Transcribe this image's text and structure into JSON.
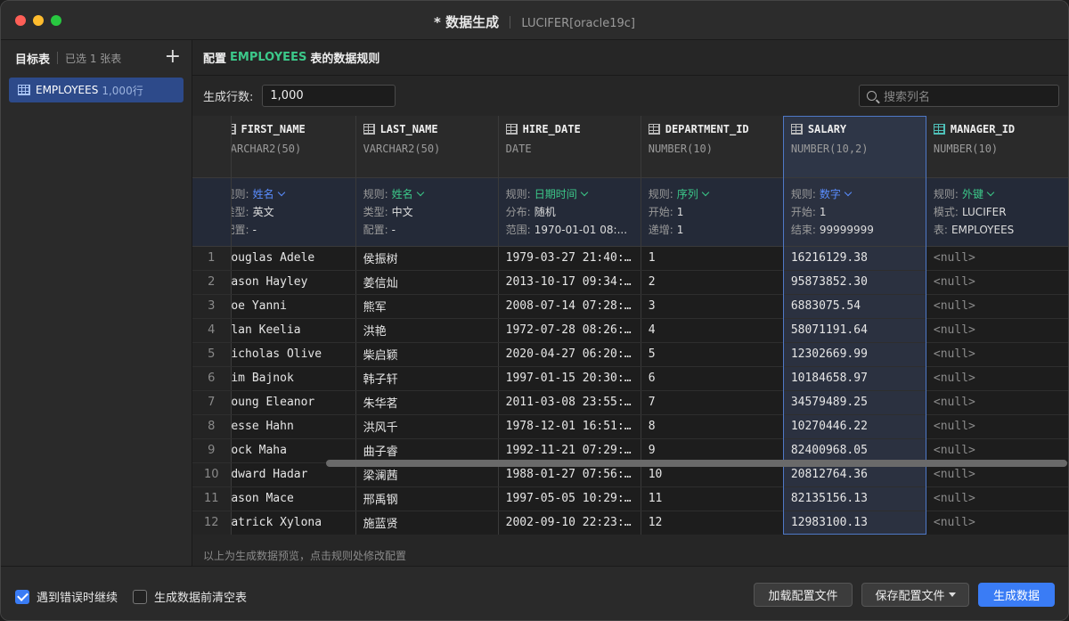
{
  "window": {
    "title": "* 数据生成",
    "connection": "LUCIFER[oracle19c]"
  },
  "sidebar": {
    "title": "目标表",
    "selected_count": "已选 1 张表",
    "add_icon": "plus-icon",
    "tables": [
      {
        "name": "EMPLOYEES",
        "rows": "1,000行"
      }
    ]
  },
  "config": {
    "prefix": "配置",
    "table": "EMPLOYEES",
    "suffix": "表的数据规则",
    "rows_label": "生成行数:",
    "rows_value": "1,000",
    "search_placeholder": "搜索列名"
  },
  "columns": [
    {
      "name": "FIRST_NAME",
      "type": "VARCHAR2(50)",
      "rules": [
        {
          "k": "规则:",
          "v": "姓名",
          "style": "blue",
          "dropdown": true
        },
        {
          "k": "类型:",
          "v": "英文"
        },
        {
          "k": "配置:",
          "v": "-"
        }
      ]
    },
    {
      "name": "LAST_NAME",
      "type": "VARCHAR2(50)",
      "rules": [
        {
          "k": "规则:",
          "v": "姓名",
          "style": "green",
          "dropdown": true
        },
        {
          "k": "类型:",
          "v": "中文"
        },
        {
          "k": "配置:",
          "v": "-"
        }
      ]
    },
    {
      "name": "HIRE_DATE",
      "type": "DATE",
      "rules": [
        {
          "k": "规则:",
          "v": "日期时间",
          "style": "green",
          "dropdown": true
        },
        {
          "k": "分布:",
          "v": "随机"
        },
        {
          "k": "范围:",
          "v": "1970-01-01 08:..."
        }
      ]
    },
    {
      "name": "DEPARTMENT_ID",
      "type": "NUMBER(10)",
      "rules": [
        {
          "k": "规则:",
          "v": "序列",
          "style": "green",
          "dropdown": true
        },
        {
          "k": "开始:",
          "v": "1"
        },
        {
          "k": "递增:",
          "v": "1"
        }
      ]
    },
    {
      "name": "SALARY",
      "type": "NUMBER(10,2)",
      "rules": [
        {
          "k": "规则:",
          "v": "数字",
          "style": "blue",
          "dropdown": true
        },
        {
          "k": "开始:",
          "v": "1"
        },
        {
          "k": "结束:",
          "v": "99999999"
        }
      ]
    },
    {
      "name": "MANAGER_ID",
      "type": "NUMBER(10)",
      "rules": [
        {
          "k": "规则:",
          "v": "外键",
          "style": "green",
          "dropdown": true
        },
        {
          "k": "模式:",
          "v": "LUCIFER"
        },
        {
          "k": "表:",
          "v": "EMPLOYEES"
        }
      ]
    }
  ],
  "rows": [
    [
      "1",
      "Douglas Adele",
      "侯振树",
      "1979-03-27 21:40:…",
      "1",
      "16216129.38",
      "<null>"
    ],
    [
      "2",
      "Mason Hayley",
      "姜信灿",
      "2013-10-17 09:34:…",
      "2",
      "95873852.30",
      "<null>"
    ],
    [
      "3",
      "Zoe Yanni",
      "熊军",
      "2008-07-14 07:28:…",
      "3",
      "6883075.54",
      "<null>"
    ],
    [
      "4",
      "Alan Keelia",
      "洪艳",
      "1972-07-28 08:26:…",
      "4",
      "58071191.64",
      "<null>"
    ],
    [
      "5",
      "Nicholas Olive",
      "柴启颖",
      "2020-04-27 06:20:…",
      "5",
      "12302669.99",
      "<null>"
    ],
    [
      "6",
      "Tim Bajnok",
      "韩子轩",
      "1997-01-15 20:30:…",
      "6",
      "10184658.97",
      "<null>"
    ],
    [
      "7",
      "Young Eleanor",
      "朱华茗",
      "2011-03-08 23:55:…",
      "7",
      "34579489.25",
      "<null>"
    ],
    [
      "8",
      "Jesse Hahn",
      "洪风千",
      "1978-12-01 16:51:…",
      "8",
      "10270446.22",
      "<null>"
    ],
    [
      "9",
      "Jock Maha",
      "曲子睿",
      "1992-11-21 07:29:…",
      "9",
      "82400968.05",
      "<null>"
    ],
    [
      "10",
      "Edward Hadar",
      "梁澜茜",
      "1988-01-27 07:56:…",
      "10",
      "20812764.36",
      "<null>"
    ],
    [
      "11",
      "Mason Mace",
      "邢禹钢",
      "1997-05-05 10:29:…",
      "11",
      "82135156.13",
      "<null>"
    ],
    [
      "12",
      "Patrick Xylona",
      "施蓝贤",
      "2002-09-10 22:23:…",
      "12",
      "12983100.13",
      "<null>"
    ]
  ],
  "preview_note": "以上为生成数据预览，点击规则处修改配置",
  "footer": {
    "continue_on_error": {
      "label": "遇到错误时继续",
      "checked": true
    },
    "truncate_before": {
      "label": "生成数据前清空表",
      "checked": false
    },
    "load_config": "加载配置文件",
    "save_config": "保存配置文件",
    "generate": "生成数据"
  },
  "colors": {
    "accent": "#3a7cf5",
    "table_name": "#3cc98a",
    "rule_blue": "#5a8dff",
    "rule_green": "#3cc98a"
  }
}
